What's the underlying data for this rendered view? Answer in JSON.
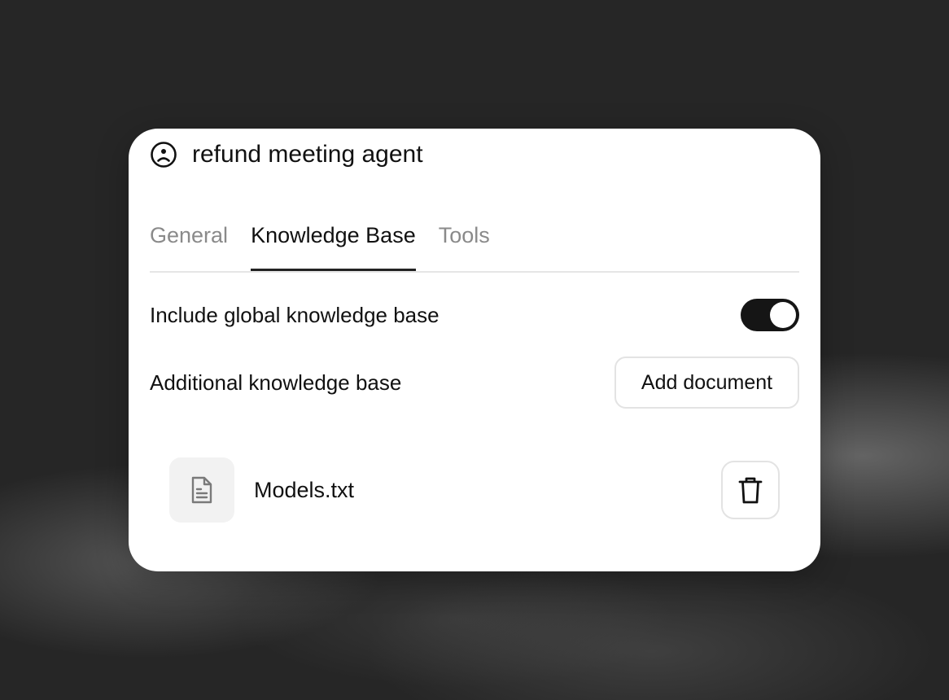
{
  "agent": {
    "title": "refund meeting agent",
    "icon": "sad-face-icon"
  },
  "tabs": [
    {
      "label": "General",
      "active": false
    },
    {
      "label": "Knowledge Base",
      "active": true
    },
    {
      "label": "Tools",
      "active": false
    }
  ],
  "knowledge_base": {
    "global_label": "Include global knowledge base",
    "global_enabled": true,
    "additional_label": "Additional knowledge base",
    "add_document_label": "Add document",
    "documents": [
      {
        "name": "Models.txt",
        "icon": "file-text-icon",
        "action_icon": "trash-icon"
      }
    ]
  },
  "colors": {
    "background": "#262626",
    "card": "#ffffff",
    "toggle_on": "#151515",
    "tab_inactive": "#8a8a8a",
    "doc_tile": "#f2f2f2"
  }
}
